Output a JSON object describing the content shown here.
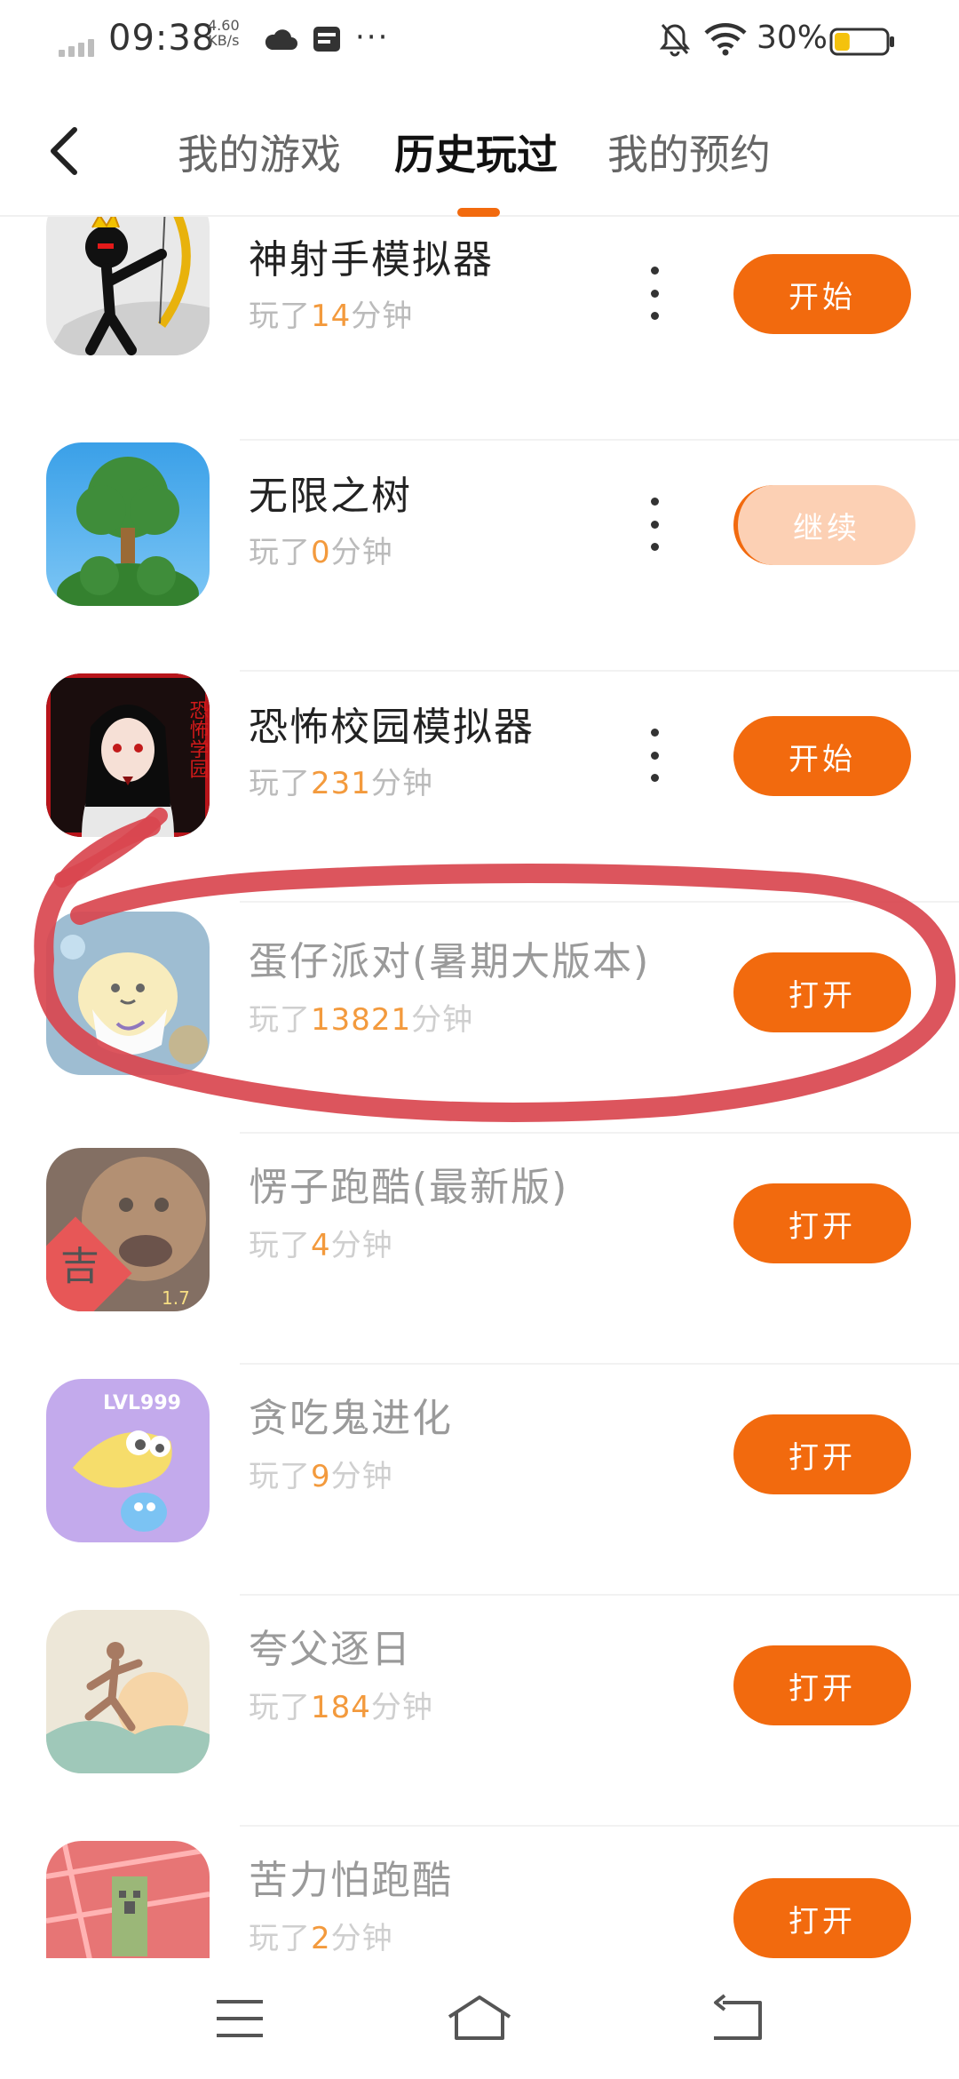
{
  "status_bar": {
    "time": "09:38",
    "net_speed_value": "4.60",
    "net_speed_unit": "KB/s",
    "more": "···",
    "battery_percent": "30%",
    "battery_level": 0.3
  },
  "header": {
    "tabs": [
      {
        "label": "我的游戏",
        "active": false
      },
      {
        "label": "历史玩过",
        "active": true
      },
      {
        "label": "我的预约",
        "active": false
      }
    ]
  },
  "games": [
    {
      "title": "神射手模拟器",
      "played_prefix": "玩了",
      "minutes": "14",
      "played_suffix": "分钟",
      "action": "开始",
      "menu": true,
      "icon": "stickman-archer-icon"
    },
    {
      "title": "无限之树",
      "played_prefix": "玩了",
      "minutes": "0",
      "played_suffix": "分钟",
      "action": "继续",
      "menu": true,
      "icon": "tree-icon"
    },
    {
      "title": "恐怖校园模拟器",
      "played_prefix": "玩了",
      "minutes": "231",
      "played_suffix": "分钟",
      "action": "开始",
      "menu": true,
      "icon": "horror-school-icon"
    },
    {
      "title": "蛋仔派对(暑期大版本)",
      "played_prefix": "玩了",
      "minutes": "13821",
      "played_suffix": "分钟",
      "action": "打开",
      "menu": false,
      "icon": "eggy-party-icon"
    },
    {
      "title": "愣子跑酷(最新版)",
      "played_prefix": "玩了",
      "minutes": "4",
      "played_suffix": "分钟",
      "action": "打开",
      "menu": false,
      "icon": "face-parkour-icon"
    },
    {
      "title": "贪吃鬼进化",
      "played_prefix": "玩了",
      "minutes": "9",
      "played_suffix": "分钟",
      "action": "打开",
      "menu": false,
      "icon": "glutton-evolution-icon"
    },
    {
      "title": "夸父逐日",
      "played_prefix": "玩了",
      "minutes": "184",
      "played_suffix": "分钟",
      "action": "打开",
      "menu": false,
      "icon": "kuafu-runner-icon"
    },
    {
      "title": "苦力怕跑酷",
      "played_prefix": "玩了",
      "minutes": "2",
      "played_suffix": "分钟",
      "action": "打开",
      "menu": false,
      "icon": "creeper-parkour-icon"
    }
  ],
  "decor": {
    "icon_badge_char": "吉",
    "icon_badge_version": "1.7",
    "icon_lvl_text": "LVL999",
    "horror_poster_text": "恐怖学园"
  },
  "colors": {
    "accent": "#f26a0e",
    "accent_light": "#fcd0b4",
    "annotation_red": "#d9474f"
  },
  "nav": {
    "items": [
      "menu-icon",
      "home-icon",
      "back-icon"
    ]
  }
}
